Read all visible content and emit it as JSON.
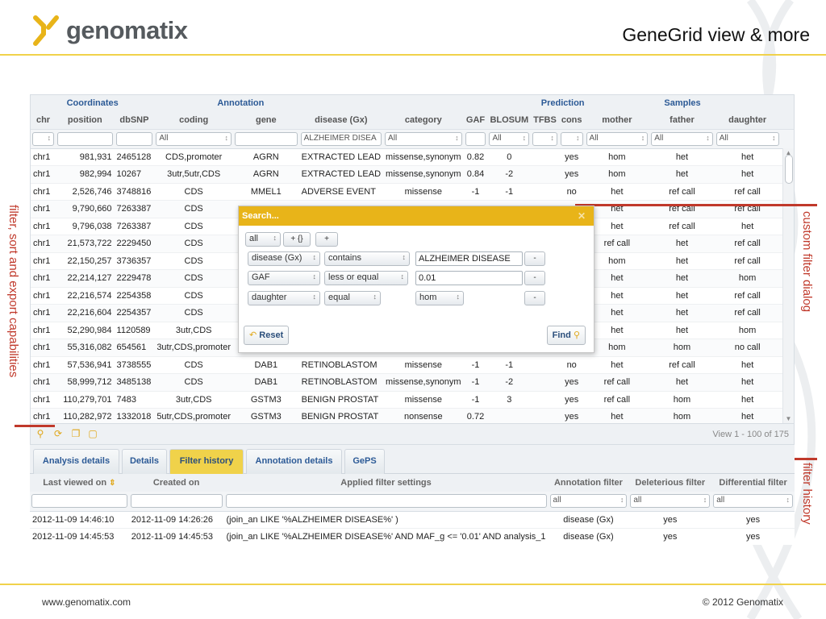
{
  "slide": {
    "brand": "genomatix",
    "title": "GeneGrid view & more",
    "footer_left": "www.genomatix.com",
    "footer_right": "© 2012 Genomatix",
    "annotation_left": "filter, sort and export capabilities",
    "annotation_right_dialog": "custom filter dialog",
    "annotation_right_history": "filter history"
  },
  "colors": {
    "accent": "#e8b419",
    "link_blue": "#2c5a96",
    "annotation_red": "#c0392b",
    "hom": "#e08a1e",
    "het": "#d63a26"
  },
  "grid": {
    "groups": [
      "Coordinates",
      "Annotation",
      "Prediction",
      "Samples"
    ],
    "columns": [
      "chr",
      "position",
      "dbSNP",
      "coding",
      "gene",
      "disease (Gx)",
      "category",
      "GAF",
      "BLOSUM",
      "TFBS",
      "cons",
      "mother",
      "father",
      "daughter"
    ],
    "filters": {
      "coding": "All",
      "disease": "ALZHEIMER DISEA",
      "category": "All",
      "blosum": "All",
      "mother": "All",
      "father": "All",
      "daughter": "All"
    },
    "rows": [
      [
        "chr1",
        "981,931",
        "2465128",
        "CDS,promoter",
        "AGRN",
        "EXTRACTED LEAD",
        "missense,synonym",
        "0.82",
        "0",
        "",
        "yes",
        "hom",
        "het",
        "het"
      ],
      [
        "chr1",
        "982,994",
        "10267",
        "3utr,5utr,CDS",
        "AGRN",
        "EXTRACTED LEAD",
        "missense,synonym",
        "0.84",
        "-2",
        "",
        "yes",
        "hom",
        "het",
        "het"
      ],
      [
        "chr1",
        "2,526,746",
        "3748816",
        "CDS",
        "MMEL1",
        "ADVERSE EVENT",
        "missense",
        "-1",
        "-1",
        "",
        "no",
        "het",
        "ref call",
        "ref call"
      ],
      [
        "chr1",
        "9,790,660",
        "7263387",
        "CDS",
        "",
        "",
        "",
        "",
        "",
        "",
        "",
        "het",
        "ref call",
        "ref call"
      ],
      [
        "chr1",
        "9,796,038",
        "7263387",
        "CDS",
        "",
        "",
        "",
        "",
        "",
        "",
        "",
        "het",
        "ref call",
        "het"
      ],
      [
        "chr1",
        "21,573,722",
        "2229450",
        "CDS",
        "",
        "",
        "",
        "",
        "",
        "",
        "",
        "ref call",
        "het",
        "ref call"
      ],
      [
        "chr1",
        "22,150,257",
        "3736357",
        "CDS",
        "",
        "",
        "",
        "",
        "",
        "",
        "",
        "hom",
        "het",
        "ref call"
      ],
      [
        "chr1",
        "22,214,127",
        "2229478",
        "CDS",
        "",
        "",
        "",
        "",
        "",
        "",
        "",
        "het",
        "het",
        "hom"
      ],
      [
        "chr1",
        "22,216,574",
        "2254358",
        "CDS",
        "",
        "",
        "",
        "",
        "",
        "",
        "",
        "het",
        "het",
        "ref call"
      ],
      [
        "chr1",
        "22,216,604",
        "2254357",
        "CDS",
        "",
        "",
        "",
        "",
        "",
        "",
        "",
        "het",
        "het",
        "ref call"
      ],
      [
        "chr1",
        "52,290,984",
        "1120589",
        "3utr,CDS",
        "",
        "",
        "",
        "",
        "",
        "",
        "",
        "het",
        "het",
        "hom"
      ],
      [
        "chr1",
        "55,316,082",
        "654561",
        "3utr,CDS,promoter",
        "",
        "",
        "",
        "",
        "",
        "",
        "",
        "hom",
        "hom",
        "no call"
      ],
      [
        "chr1",
        "57,536,941",
        "3738555",
        "CDS",
        "DAB1",
        "RETINOBLASTOM",
        "missense",
        "-1",
        "-1",
        "",
        "no",
        "het",
        "ref call",
        "het"
      ],
      [
        "chr1",
        "58,999,712",
        "3485138",
        "CDS",
        "DAB1",
        "RETINOBLASTOM",
        "missense,synonym",
        "-1",
        "-2",
        "",
        "yes",
        "ref call",
        "het",
        "het"
      ],
      [
        "chr1",
        "110,279,701",
        "7483",
        "3utr,CDS",
        "GSTM3",
        "BENIGN PROSTAT",
        "missense",
        "-1",
        "3",
        "",
        "yes",
        "ref call",
        "hom",
        "het"
      ],
      [
        "chr1",
        "110,282,972",
        "1332018",
        "5utr,CDS,promoter",
        "GSTM3",
        "BENIGN PROSTAT",
        "nonsense",
        "0.72",
        "",
        "",
        "yes",
        "het",
        "hom",
        "het"
      ]
    ],
    "pager_info": "View 1 - 100 of 175"
  },
  "dialog": {
    "title": "Search...",
    "match_mode": "all",
    "add_group_label": "+ {}",
    "add_rule_label": "+",
    "remove_label": "-",
    "rules": [
      {
        "field": "disease (Gx)",
        "op": "contains",
        "value": "ALZHEIMER DISEASE",
        "type": "input"
      },
      {
        "field": "GAF",
        "op": "less or equal",
        "value": "0.01",
        "type": "input"
      },
      {
        "field": "daughter",
        "op": "equal",
        "value": "hom",
        "type": "select"
      }
    ],
    "reset_label": "Reset",
    "find_label": "Find"
  },
  "tabs": [
    {
      "label": "Analysis details",
      "active": false
    },
    {
      "label": "Details",
      "active": false
    },
    {
      "label": "Filter history",
      "active": true
    },
    {
      "label": "Annotation details",
      "active": false
    },
    {
      "label": "GePS",
      "active": false
    }
  ],
  "history": {
    "columns": [
      "Last viewed on",
      "Created on",
      "Applied filter settings",
      "Annotation filter",
      "Deleterious filter",
      "Differential filter"
    ],
    "filter_values": {
      "annotation": "all",
      "deleterious": "all",
      "differential": "all"
    },
    "rows": [
      [
        "2012-11-09 14:46:10",
        "2012-11-09 14:26:26",
        "(join_an  LIKE   '%ALZHEIMER DISEASE%' )",
        "disease (Gx)",
        "yes",
        "yes"
      ],
      [
        "2012-11-09 14:45:53",
        "2012-11-09 14:45:53",
        "(join_an  LIKE   '%ALZHEIMER DISEASE%'  AND MAF_g <=  '0.01'  AND analysis_1",
        "disease (Gx)",
        "yes",
        "yes"
      ]
    ]
  }
}
